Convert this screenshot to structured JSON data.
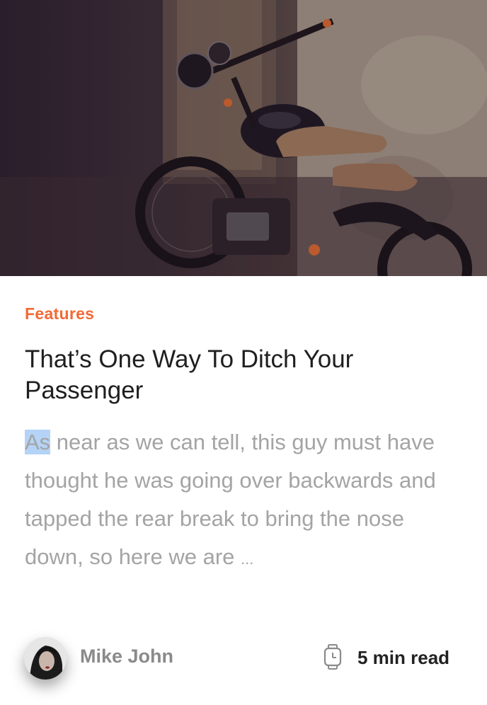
{
  "article": {
    "category": "Features",
    "title": "That’s One Way To Ditch Your Passenger",
    "excerpt_highlight": "As",
    "excerpt_rest": " near as we can tell, this guy must have thought he was going over backwards and tapped the rear break to bring the nose down, so here we are ",
    "excerpt_ellipsis": "...",
    "author": "Mike John",
    "read_time": "5 min read"
  },
  "colors": {
    "accent": "#f26a35",
    "title": "#1f1f1f",
    "excerpt": "#a4a4a4",
    "selection": "#b4d3f7"
  },
  "icons": {
    "read_time_icon": "watch-icon"
  }
}
